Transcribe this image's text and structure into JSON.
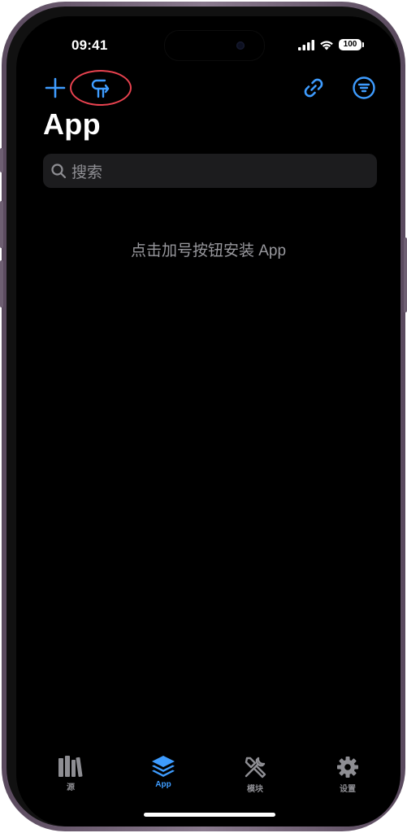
{
  "status_bar": {
    "time": "09:41",
    "battery": "100"
  },
  "nav": {
    "add_icon": "plus-icon",
    "sources_icon": "fork-arrows-icon",
    "link_icon": "link-icon",
    "filter_icon": "filter-menu-icon",
    "highlight_color": "#e8424f"
  },
  "page": {
    "title": "App",
    "search_placeholder": "搜索",
    "empty_message": "点击加号按钮安装 App"
  },
  "tabbar": {
    "tabs": [
      {
        "label": "源",
        "icon": "books-icon",
        "active": false
      },
      {
        "label": "App",
        "icon": "layers-icon",
        "active": true
      },
      {
        "label": "模块",
        "icon": "tools-icon",
        "active": false
      },
      {
        "label": "设置",
        "icon": "gear-icon",
        "active": false
      }
    ]
  },
  "colors": {
    "accent": "#3e9cff",
    "background": "#000000",
    "inactive": "#8e8e93"
  }
}
